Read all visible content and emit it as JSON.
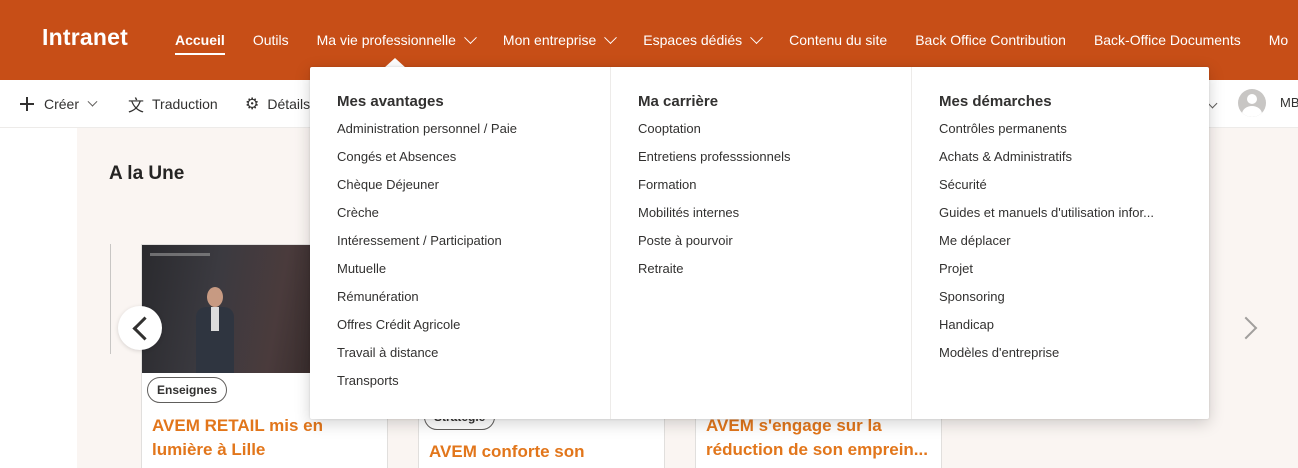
{
  "site": {
    "title": "Intranet"
  },
  "nav": [
    {
      "label": "Accueil",
      "dropdown": false,
      "active": true
    },
    {
      "label": "Outils",
      "dropdown": false
    },
    {
      "label": "Ma vie professionnelle",
      "dropdown": true
    },
    {
      "label": "Mon entreprise",
      "dropdown": true
    },
    {
      "label": "Espaces dédiés",
      "dropdown": true
    },
    {
      "label": "Contenu du site",
      "dropdown": false
    },
    {
      "label": "Back Office Contribution",
      "dropdown": false
    },
    {
      "label": "Back-Office Documents",
      "dropdown": false
    },
    {
      "label": "Mo",
      "dropdown": false
    }
  ],
  "commandbar": {
    "create_label": "Créer",
    "translate_label": "Traduction",
    "details_label": "Détails",
    "user_initials": "MB"
  },
  "section": {
    "title": "A la Une"
  },
  "cards": [
    {
      "tag": "Enseignes",
      "title": "AVEM RETAIL mis en lumière à Lille"
    },
    {
      "tag": "Stratégie",
      "title": "AVEM conforte son"
    },
    {
      "tag": "",
      "title": "AVEM s'engage sur la réduction de son emprein..."
    }
  ],
  "mega_menu": {
    "columns": [
      {
        "heading": "Mes avantages",
        "links": [
          "Administration personnel / Paie",
          "Congés et Absences",
          "Chèque Déjeuner",
          "Crèche",
          "Intéressement / Participation",
          "Mutuelle",
          "Rémunération",
          "Offres Crédit Agricole",
          "Travail à distance",
          "Transports"
        ]
      },
      {
        "heading": "Ma carrière",
        "links": [
          "Cooptation",
          "Entretiens professsionnels",
          "Formation",
          "Mobilités internes",
          "Poste à pourvoir",
          "Retraite"
        ]
      },
      {
        "heading": "Mes démarches",
        "links": [
          "Contrôles permanents",
          "Achats & Administratifs",
          "Sécurité",
          "Guides et manuels d'utilisation infor...",
          "Me déplacer",
          "Projet",
          "Sponsoring",
          "Handicap",
          "Modèles d'entreprise"
        ]
      }
    ]
  },
  "colors": {
    "brand": "#c74e17",
    "accent_title": "#e2761b",
    "background": "#faf5f2"
  },
  "icons": [
    "plus-icon",
    "translate-icon",
    "gear-icon",
    "chevron-down-icon",
    "chevron-left-icon",
    "chevron-right-icon",
    "avatar-icon"
  ]
}
